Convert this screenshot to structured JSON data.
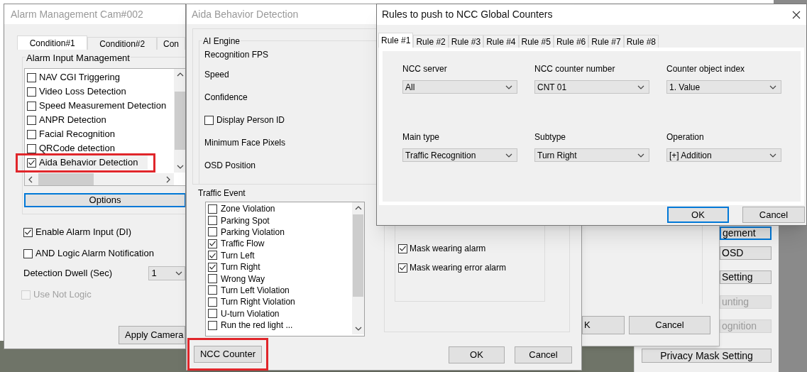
{
  "right_panel": {
    "buttons": [
      {
        "label": "gement",
        "disabled": false,
        "focused": true
      },
      {
        "label": "OSD",
        "disabled": false,
        "focused": false
      },
      {
        "label": "Setting",
        "disabled": false,
        "focused": false
      },
      {
        "label": "unting",
        "disabled": true,
        "focused": false
      },
      {
        "label": "ognition",
        "disabled": true,
        "focused": false
      },
      {
        "label": "Privacy Mask Setting",
        "disabled": false,
        "focused": false
      }
    ]
  },
  "back_dialog": {
    "buttons": [
      "K",
      "Cancel"
    ]
  },
  "alarm_window": {
    "title": "Alarm Management Cam#002",
    "tabs": [
      {
        "label": "Condition#1",
        "selected": true
      },
      {
        "label": "Condition#2",
        "selected": false
      },
      {
        "label": "Con",
        "selected": false
      }
    ],
    "group_label": "Alarm Input Management",
    "inputs": [
      {
        "label": "NAV CGI Triggering",
        "checked": false,
        "highlighted": false
      },
      {
        "label": "Video Loss Detection",
        "checked": false,
        "highlighted": false
      },
      {
        "label": "Speed Measurement Detection",
        "checked": false,
        "highlighted": false
      },
      {
        "label": "ANPR Detection",
        "checked": false,
        "highlighted": false
      },
      {
        "label": "Facial Recognition",
        "checked": false,
        "highlighted": false
      },
      {
        "label": "QRCode detection",
        "checked": false,
        "highlighted": false
      },
      {
        "label": "Aida Behavior Detection",
        "checked": true,
        "highlighted": true
      }
    ],
    "options_button": {
      "label": "Options",
      "focused": true
    },
    "settings": [
      {
        "kind": "checkbox",
        "label": "Enable Alarm Input (DI)",
        "checked": true,
        "disabled": false
      },
      {
        "kind": "checkbox",
        "label": "AND Logic Alarm Notification",
        "checked": false,
        "disabled": false
      },
      {
        "kind": "dropdown",
        "label": "Detection Dwell (Sec)",
        "value": "1"
      },
      {
        "kind": "checkbox",
        "label": "Use Not Logic",
        "checked": false,
        "disabled": true
      }
    ],
    "apply_button": "Apply Camera"
  },
  "aida_window": {
    "title": "Aida Behavior Detection",
    "ai_engine": {
      "label": "AI Engine",
      "fields": [
        {
          "kind": "label",
          "label": "Recognition FPS"
        },
        {
          "kind": "label",
          "label": "Speed"
        },
        {
          "kind": "label",
          "label": "Confidence"
        },
        {
          "kind": "checkbox",
          "label": "Display Person ID",
          "checked": false
        },
        {
          "kind": "label",
          "label": "Minimum Face Pixels"
        },
        {
          "kind": "label",
          "label": "OSD Position"
        }
      ]
    },
    "traffic_event": {
      "label": "Traffic Event",
      "items": [
        {
          "label": "Zone Violation",
          "checked": false
        },
        {
          "label": "Parking Spot",
          "checked": false
        },
        {
          "label": "Parking Violation",
          "checked": false
        },
        {
          "label": "Traffic Flow",
          "checked": true
        },
        {
          "label": "Turn Left",
          "checked": true
        },
        {
          "label": "Turn Right",
          "checked": true
        },
        {
          "label": "Wrong Way",
          "checked": false
        },
        {
          "label": "Turn Left Violation",
          "checked": false
        },
        {
          "label": "Turn Right Violation",
          "checked": false
        },
        {
          "label": "U-turn Violation",
          "checked": false
        },
        {
          "label": "Run the red light ...",
          "checked": false
        }
      ]
    },
    "mask_alarms": [
      {
        "label": "Mask wearing alarm",
        "checked": true
      },
      {
        "label": "Mask wearing error alarm",
        "checked": true
      }
    ],
    "ncc_button": {
      "label": "NCC Counter",
      "highlighted": true
    },
    "ok": "OK",
    "cancel": "Cancel"
  },
  "rules_dialog": {
    "title": "Rules to push to NCC Global Counters",
    "tabs": [
      {
        "label": "Rule #1",
        "selected": true
      },
      {
        "label": "Rule #2",
        "selected": false
      },
      {
        "label": "Rule #3",
        "selected": false
      },
      {
        "label": "Rule #4",
        "selected": false
      },
      {
        "label": "Rule #5",
        "selected": false
      },
      {
        "label": "Rule #6",
        "selected": false
      },
      {
        "label": "Rule #7",
        "selected": false
      },
      {
        "label": "Rule #8",
        "selected": false
      }
    ],
    "fields": [
      {
        "label": "NCC server",
        "value": "All"
      },
      {
        "label": "NCC counter number",
        "value": "CNT 01"
      },
      {
        "label": "Counter object index",
        "value": "1. Value"
      },
      {
        "label": "Main type",
        "value": "Traffic Recognition"
      },
      {
        "label": "Subtype",
        "value": "Turn Right"
      },
      {
        "label": "Operation",
        "value": "[+] Addition"
      }
    ],
    "ok": {
      "label": "OK",
      "focused": true
    },
    "cancel": "Cancel"
  }
}
